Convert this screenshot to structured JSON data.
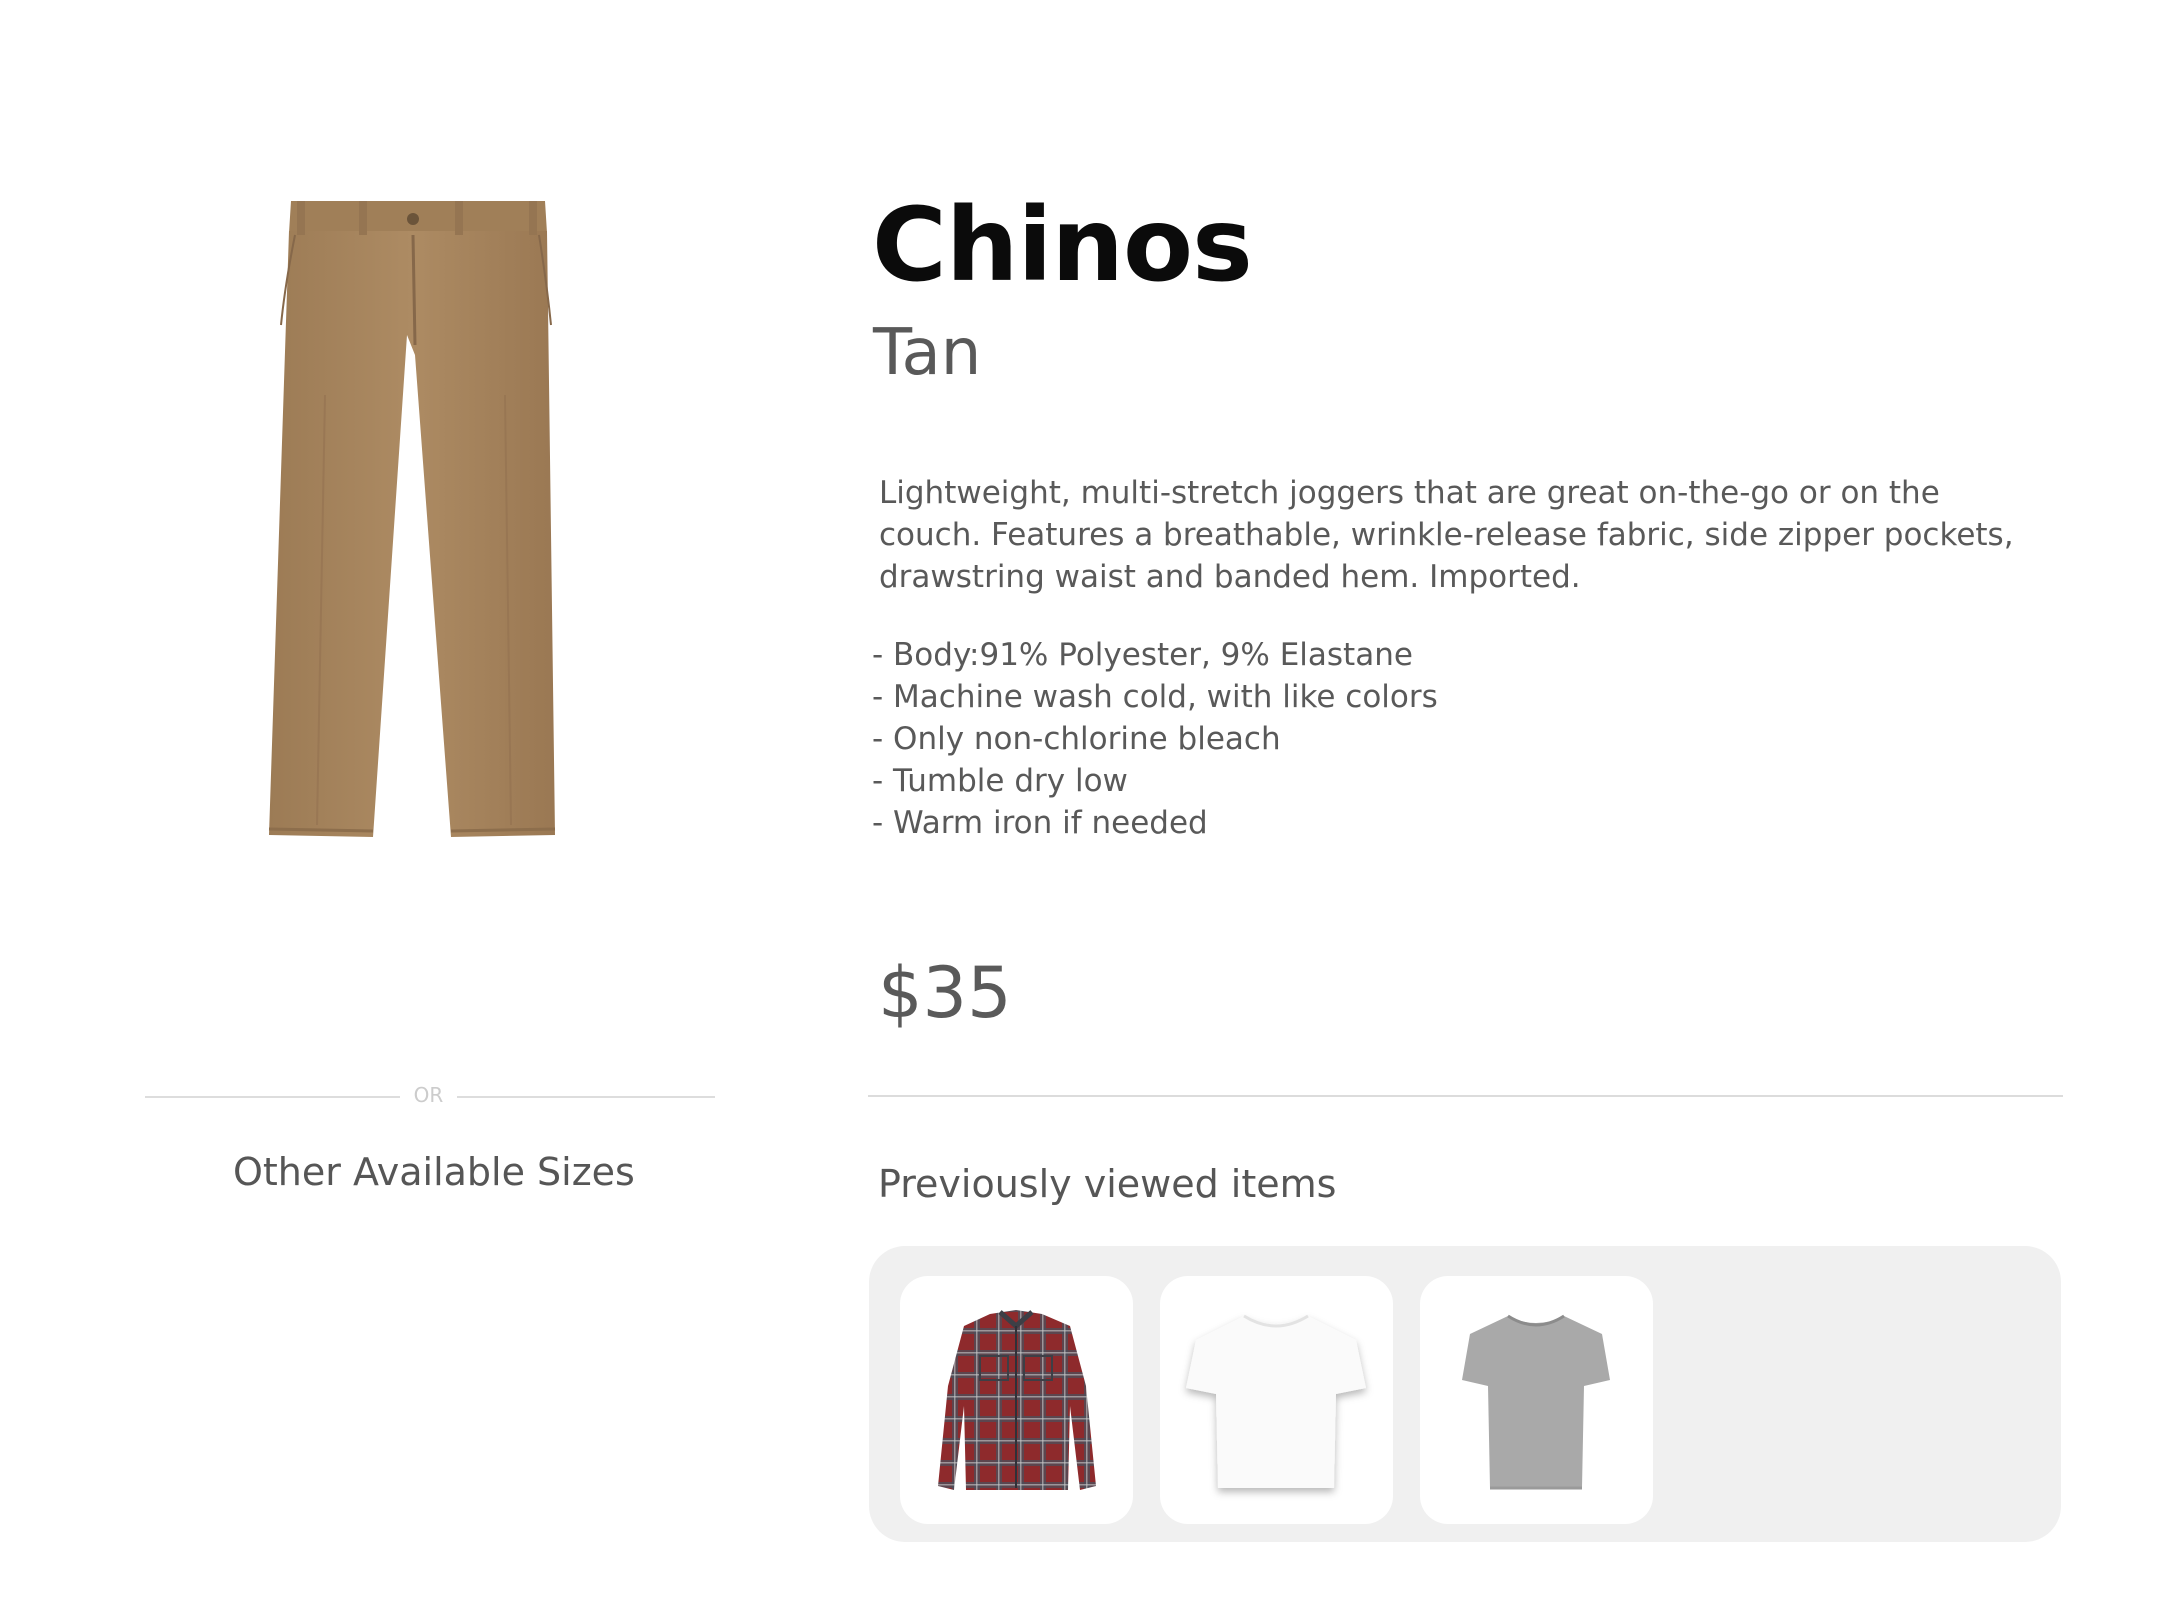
{
  "product": {
    "name": "Chinos",
    "color": "Tan",
    "description": "Lightweight, multi-stretch joggers that are great on-the-go or on the couch. Features a breathable, wrinkle-release fabric, side zipper pockets, drawstring waist and banded hem. Imported.",
    "specs": [
      "- Body:91% Polyester, 9% Elastane",
      "- Machine wash cold, with like colors",
      "- Only non-chlorine bleach",
      "- Tumble dry low",
      "- Warm iron if needed"
    ],
    "price": "$35",
    "image_icon": "tan-chino-pants-image"
  },
  "divider": {
    "or_label": "OR"
  },
  "sizes": {
    "heading": "Other Available Sizes"
  },
  "previously_viewed": {
    "heading": "Previously viewed items",
    "items": [
      {
        "icon": "red-plaid-flannel-shirt-image"
      },
      {
        "icon": "white-tshirt-image"
      },
      {
        "icon": "gray-tshirt-image"
      }
    ]
  },
  "colors": {
    "pants_tan": "#a8865e",
    "panel_bg": "#f0f0f0",
    "divider": "#dddddd"
  }
}
